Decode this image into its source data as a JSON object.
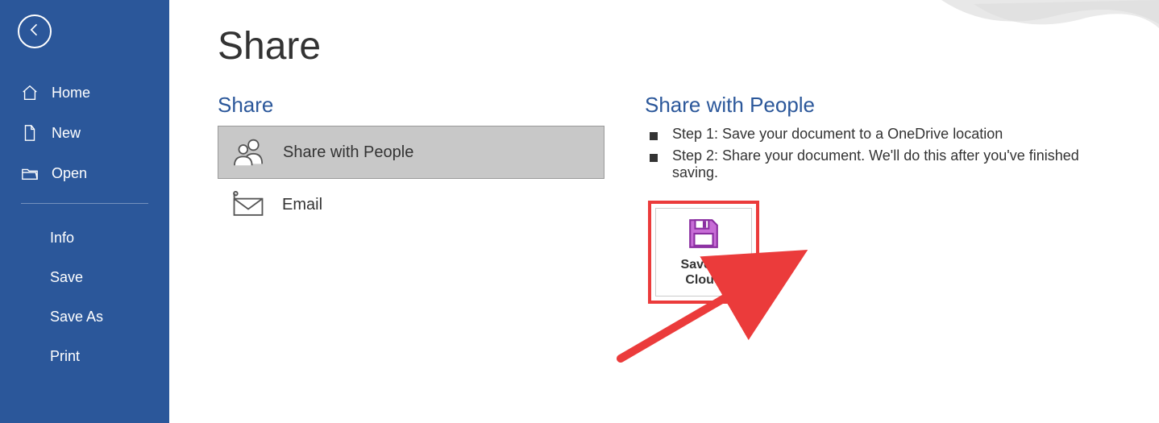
{
  "sidebar": {
    "items": [
      {
        "label": "Home"
      },
      {
        "label": "New"
      },
      {
        "label": "Open"
      }
    ],
    "sub_items": [
      {
        "label": "Info"
      },
      {
        "label": "Save"
      },
      {
        "label": "Save As"
      },
      {
        "label": "Print"
      }
    ]
  },
  "page": {
    "title": "Share"
  },
  "share_section": {
    "title": "Share",
    "options": [
      {
        "label": "Share with People",
        "selected": true
      },
      {
        "label": "Email",
        "selected": false
      }
    ]
  },
  "share_with_people": {
    "title": "Share with People",
    "steps": [
      "Step 1: Save your document to a OneDrive location",
      "Step 2: Share your document. We'll do this after you've finished saving."
    ],
    "button_label_line1": "Save to",
    "button_label_line2": "Cloud"
  }
}
